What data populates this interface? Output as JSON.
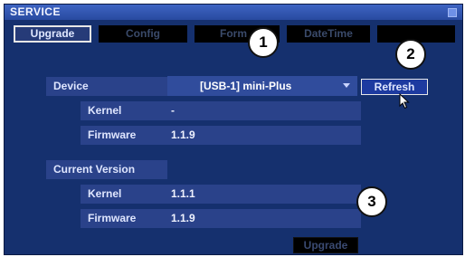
{
  "window": {
    "title": "SERVICE"
  },
  "tabs": [
    {
      "label": "Upgrade",
      "active": true
    },
    {
      "label": "Config",
      "active": false
    },
    {
      "label": "Form",
      "active": false
    },
    {
      "label": "DateTime",
      "active": false
    },
    {
      "label": "",
      "active": false
    }
  ],
  "device": {
    "label": "Device",
    "selected": "[USB-1] mini-Plus",
    "refresh_label": "Refresh",
    "kernel_label": "Kernel",
    "kernel_value": "-",
    "firmware_label": "Firmware",
    "firmware_value": "1.1.9"
  },
  "current_version": {
    "label": "Current Version",
    "kernel_label": "Kernel",
    "kernel_value": "1.1.1",
    "firmware_label": "Firmware",
    "firmware_value": "1.1.9"
  },
  "upgrade_label": "Upgrade",
  "callouts": [
    "1",
    "2",
    "3"
  ],
  "colors": {
    "panel": "#15306e",
    "title_bar": "#284aa0",
    "row": "#2a428a"
  }
}
